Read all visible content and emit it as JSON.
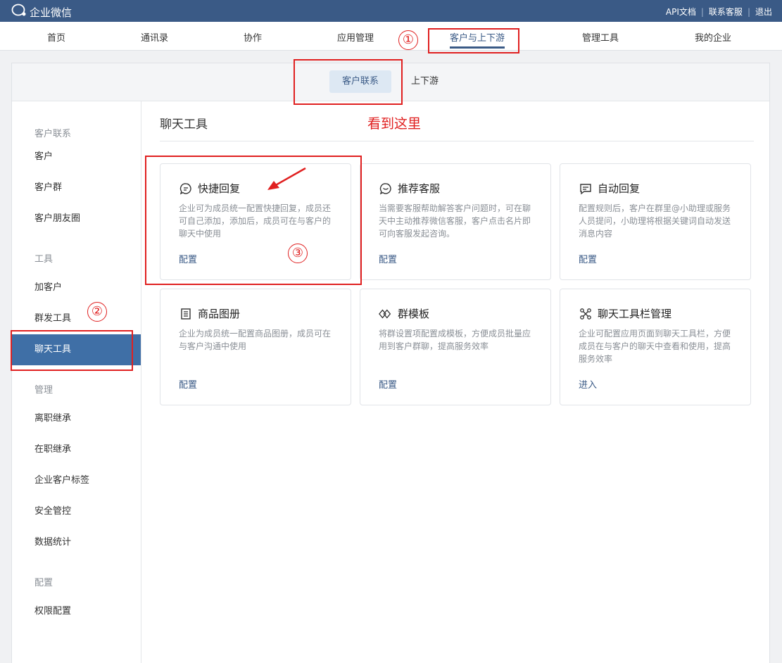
{
  "topbar": {
    "app_name": "企业微信",
    "links": [
      "API文档",
      "联系客服",
      "退出"
    ],
    "separator": "|"
  },
  "mainnav": {
    "items": [
      "首页",
      "通讯录",
      "协作",
      "应用管理",
      "客户与上下游",
      "管理工具",
      "我的企业"
    ],
    "active": "客户与上下游"
  },
  "subtabs": {
    "items": [
      "客户联系",
      "上下游"
    ],
    "active": "客户联系"
  },
  "sidebar": {
    "groups": [
      {
        "label": "客户联系",
        "items": [
          "客户",
          "客户群",
          "客户朋友圈"
        ]
      },
      {
        "label": "工具",
        "items": [
          "加客户",
          "群发工具",
          "聊天工具"
        ]
      },
      {
        "label": "管理",
        "items": [
          "离职继承",
          "在职继承",
          "企业客户标签",
          "安全管控",
          "数据统计"
        ]
      },
      {
        "label": "配置",
        "items": [
          "权限配置"
        ]
      }
    ],
    "active": "聊天工具"
  },
  "main": {
    "title": "聊天工具",
    "annotation": "看到这里",
    "cards": [
      {
        "title": "快捷回复",
        "icon": "chat-bubble-icon",
        "desc": "企业可为成员统一配置快捷回复，成员还可自己添加，添加后，成员可在与客户的聊天中使用",
        "action": "配置"
      },
      {
        "title": "推荐客服",
        "icon": "service-chat-icon",
        "desc": "当需要客服帮助解答客户问题时，可在聊天中主动推荐微信客服，客户点击名片即可向客服发起咨询。",
        "action": "配置"
      },
      {
        "title": "自动回复",
        "icon": "auto-reply-icon",
        "desc": "配置规则后，客户在群里@小助理或服务人员提问，小助理将根据关键词自动发送消息内容",
        "action": "配置"
      },
      {
        "title": "商品图册",
        "icon": "catalog-icon",
        "desc": "企业为成员统一配置商品图册，成员可在与客户沟通中使用",
        "action": "配置"
      },
      {
        "title": "群模板",
        "icon": "template-icon",
        "desc": "将群设置项配置成模板，方便成员批量应用到客户群聊，提高服务效率",
        "action": "配置"
      },
      {
        "title": "聊天工具栏管理",
        "icon": "toolbar-icon",
        "desc": "企业可配置应用页面到聊天工具栏，方便成员在与客户的聊天中查看和使用，提高服务效率",
        "action": "进入"
      }
    ]
  },
  "annotations": {
    "step1": "①",
    "step2": "②",
    "step3": "③",
    "color": "#e02020"
  },
  "colors": {
    "topbar": "#3a5a86",
    "accent": "#3f6fa6",
    "annotation": "#e02020"
  }
}
